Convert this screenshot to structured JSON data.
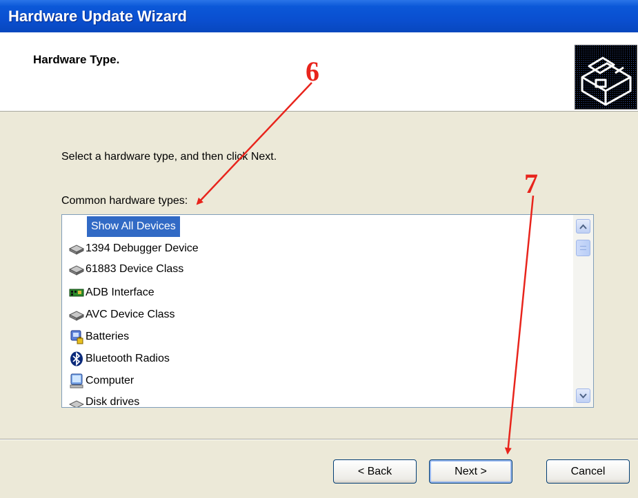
{
  "window": {
    "title": "Hardware Update Wizard"
  },
  "header": {
    "title": "Hardware Type.",
    "icon": "hardware-box-icon"
  },
  "body": {
    "instruction": "Select a hardware type, and then click Next.",
    "list_label": "Common hardware types:"
  },
  "hardware_list": {
    "items": [
      {
        "label": "Show All Devices",
        "icon": "none",
        "selected": true
      },
      {
        "label": "1394 Debugger Device",
        "icon": "device-disk-icon"
      },
      {
        "label": "61883 Device Class",
        "icon": "device-disk-icon"
      },
      {
        "label": "ADB Interface",
        "icon": "circuit-board-icon"
      },
      {
        "label": "AVC Device Class",
        "icon": "device-disk-icon"
      },
      {
        "label": "Batteries",
        "icon": "battery-icon"
      },
      {
        "label": "Bluetooth Radios",
        "icon": "bluetooth-icon"
      },
      {
        "label": "Computer",
        "icon": "computer-icon"
      },
      {
        "label": "Disk drives",
        "icon": "disk-drive-icon"
      }
    ]
  },
  "buttons": {
    "back": "< Back",
    "next": "Next >",
    "cancel": "Cancel"
  },
  "annotations": {
    "step_6": "6",
    "step_7": "7"
  },
  "colors": {
    "titlebar": "#0a4fd0",
    "selection": "#316ac5",
    "dialog_bg": "#ece9d8",
    "annotation": "#e8241c"
  }
}
